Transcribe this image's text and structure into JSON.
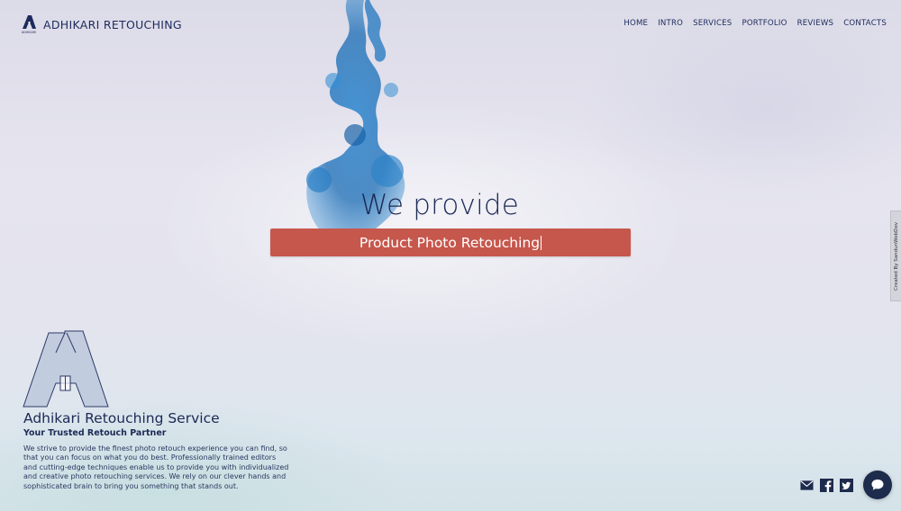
{
  "header": {
    "logo_text": "ADHIKARI",
    "brand_name": "ADHIKARI RETOUCHING",
    "nav": [
      "HOME",
      "INTRO",
      "SERVICES",
      "PORTFOLIO",
      "REVIEWS",
      "CONTACTS"
    ]
  },
  "hero": {
    "title": "We provide",
    "typed_text": "Product Photo Retouching"
  },
  "side_tab": {
    "label": "Created By SandunWebDev"
  },
  "about": {
    "title": "Adhikari Retouching Service",
    "subtitle": "Your Trusted Retouch Partner",
    "description": "We strive to provide the finest photo retouch experience you can find, so that you can focus on what you do best. Professionally trained editors and cutting-edge techniques enable us to provide you with individualized and creative photo retouching services. We rely on our clever hands and sophisticated brain to bring you something that stands out."
  },
  "social": [
    "mail-icon",
    "facebook-icon",
    "twitter-icon"
  ],
  "chat": {
    "icon": "chat-bubble-icon"
  },
  "colors": {
    "accent": "#c6574c",
    "navy": "#1c2a55",
    "chat_bg": "#1d2b4d",
    "ink": "#1e6fb5"
  }
}
